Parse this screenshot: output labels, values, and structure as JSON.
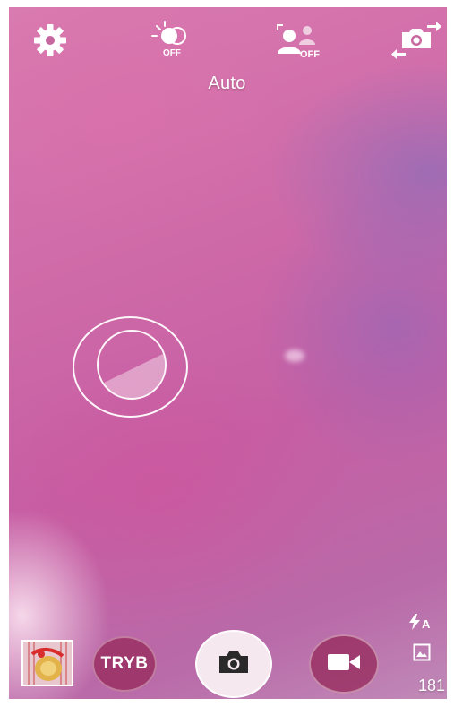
{
  "top_bar": {
    "settings_icon": "gear-icon",
    "hdr": {
      "icon": "hdr-toggle-icon",
      "state_label": "OFF"
    },
    "face_detect": {
      "icon": "face-detection-icon",
      "state_label": "OFF"
    },
    "switch_camera_icon": "switch-camera-icon"
  },
  "mode_label": "Auto",
  "focus": {
    "icon": "focus-exposure-icon"
  },
  "bottom_bar": {
    "gallery_thumbnail_icon": "gallery-thumbnail",
    "mode_button_label": "TRYB",
    "shutter_icon": "camera-icon",
    "video_icon": "video-camera-icon"
  },
  "status": {
    "flash_icon": "flash-icon",
    "flash_mode": "A",
    "storage_icon": "image-storage-icon",
    "remaining_shots": "181"
  },
  "colors": {
    "overlay_button": "#962f5a",
    "shutter_bg": "#f6e8ef",
    "icon": "#ffffff",
    "shutter_icon": "#2a2a2a"
  }
}
